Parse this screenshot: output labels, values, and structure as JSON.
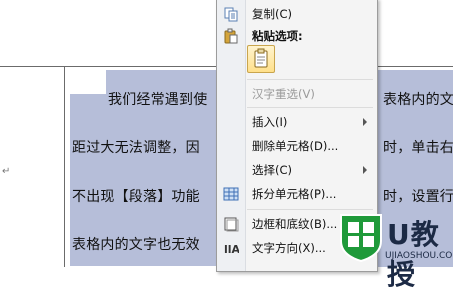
{
  "document": {
    "lines": [
      "我们经常遇到使",
      "距过大无法调整，因",
      "不出现【段落】功能",
      "表格内的文字也无效"
    ],
    "right_fragments": [
      "表格内的文",
      "时，单击右",
      "时，设置行",
      ""
    ],
    "paragraph_mark": "↵"
  },
  "context_menu": {
    "items": [
      {
        "label": "复制(C)",
        "icon": "copy-icon",
        "disabled": false,
        "submenu": false
      },
      {
        "label": "粘贴选项:",
        "icon": "paste-icon",
        "header": true
      },
      {
        "label": "汉字重选(V)",
        "disabled": true,
        "submenu": false
      },
      {
        "label": "插入(I)",
        "disabled": false,
        "submenu": true
      },
      {
        "label": "删除单元格(D)...",
        "disabled": false,
        "submenu": false
      },
      {
        "label": "选择(C)",
        "disabled": false,
        "submenu": true
      },
      {
        "label": "拆分单元格(P)...",
        "icon": "split-cells-icon",
        "disabled": false,
        "submenu": false
      },
      {
        "label": "边框和底纹(B)...",
        "icon": "borders-icon",
        "disabled": false,
        "submenu": false
      },
      {
        "label": "文字方向(X)...",
        "icon": "text-direction-icon",
        "disabled": false,
        "submenu": false
      }
    ]
  },
  "watermark": {
    "brand": "U教授",
    "url": "UJIAOSHOU.COM"
  },
  "colors": {
    "selection": "#b6bed9",
    "watermark_green": "#1f9a3a",
    "watermark_dark": "#1c2a45"
  }
}
